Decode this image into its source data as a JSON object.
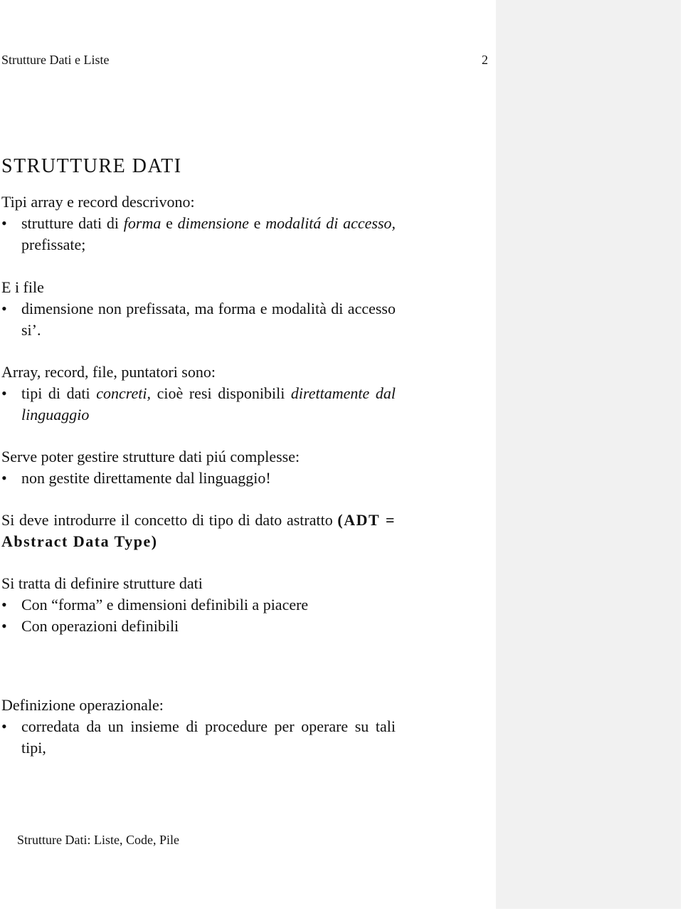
{
  "header": {
    "running_title": "Strutture Dati e Liste",
    "page_number": "2"
  },
  "title": "STRUTTURE DATI",
  "sections": {
    "s1": {
      "intro": "Tipi array e record descrivono:",
      "bullet": {
        "t1": "strutture dati di ",
        "i1": "forma",
        "t2": " e ",
        "i2": "dimensione",
        "t3": " e ",
        "i3": "modalitá di accesso,",
        "t4": " prefissate;"
      }
    },
    "s2": {
      "intro": "E i file",
      "bullet": "dimensione non prefissata, ma forma e modalità di accesso si’."
    },
    "s3": {
      "intro": "Array, record, file, puntatori sono:",
      "bullet": {
        "t1": "tipi di dati ",
        "i1": "concreti,",
        "t2": " cioè resi disponibili ",
        "i2": "direttamente dal linguaggio"
      }
    },
    "s4": {
      "intro": "Serve poter gestire strutture dati piú complesse:",
      "bullet": "non gestite direttamente dal linguaggio!"
    },
    "s5": {
      "text": "Si deve introdurre il concetto di tipo di dato astratto ",
      "adt": "(ADT = Abstract Data Type)"
    },
    "s6": {
      "intro": "Si tratta di definire strutture dati",
      "bullets": [
        "Con “forma” e dimensioni definibili a piacere",
        "Con operazioni definibili"
      ]
    },
    "s7": {
      "intro": "Definizione operazionale:",
      "bullet": "corredata da un insieme di procedure per operare su tali tipi,"
    }
  },
  "bullet_symbol": "•",
  "footer": {
    "text": "Strutture Dati: Liste, Code, Pile"
  },
  "colors": {
    "text": "#111111",
    "page_background": "#ffffff",
    "side_panel": "#f1f1f1"
  }
}
